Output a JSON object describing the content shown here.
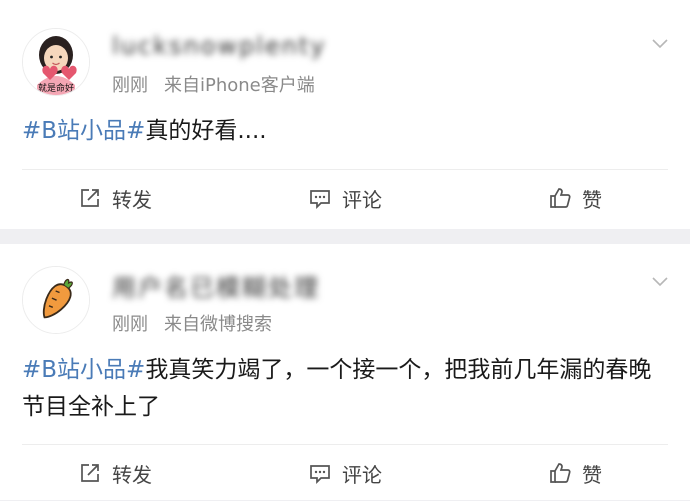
{
  "posts": [
    {
      "username": "lucksnowplenty",
      "time": "刚刚",
      "source": "来自iPhone客户端",
      "avatar_caption": "就是命好",
      "hashtag": "#B站小品#",
      "text": "真的好看....",
      "actions": {
        "repost": "转发",
        "comment": "评论",
        "like": "赞"
      }
    },
    {
      "username": "用户名已模糊处理",
      "time": "刚刚",
      "source": "来自微博搜索",
      "hashtag": "#B站小品#",
      "text": "我真笑力竭了，一个接一个，把我前几年漏的春晚节目全补上了",
      "actions": {
        "repost": "转发",
        "comment": "评论",
        "like": "赞"
      }
    }
  ],
  "colors": {
    "hashtag": "#4a7bb7",
    "meta": "#8a8a8a",
    "background": "#efeff2"
  }
}
